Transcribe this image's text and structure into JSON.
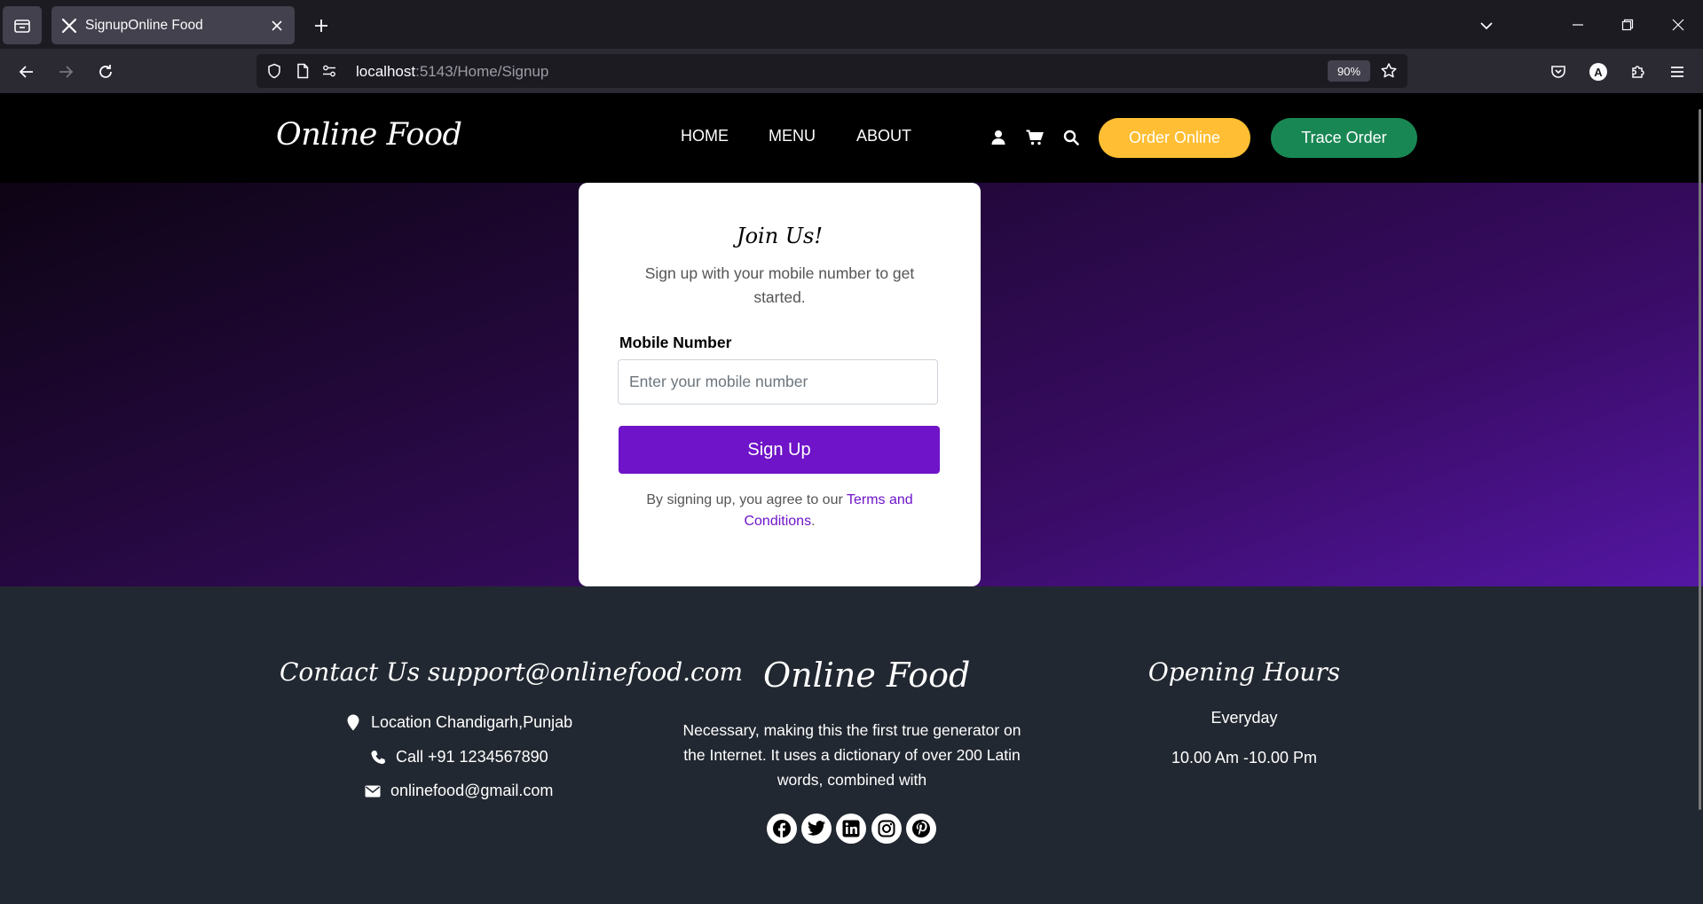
{
  "browser": {
    "tab_title": "SignupOnline Food",
    "url_host": "localhost",
    "url_rest": ":5143/Home/Signup",
    "zoom": "90%"
  },
  "header": {
    "brand": "Online Food",
    "nav": [
      "HOME",
      "MENU",
      "ABOUT"
    ],
    "order_online": "Order Online",
    "trace_order": "Trace Order"
  },
  "signup": {
    "title": "Join Us!",
    "subtitle": "Sign up with your mobile number to get started.",
    "mobile_label": "Mobile Number",
    "mobile_placeholder": "Enter your mobile number",
    "button": "Sign Up",
    "terms_prefix": "By signing up, you agree to our ",
    "terms_link": "Terms and Conditions",
    "terms_suffix": "."
  },
  "footer": {
    "contact_heading": "Contact Us support@onlinefood.com",
    "location": "Location Chandigarh,Punjab",
    "phone": "Call +91 1234567890",
    "email": "onlinefood@gmail.com",
    "brand": "Online Food",
    "description": "Necessary, making this the first true generator on the Internet. It uses a dictionary of over 200 Latin words, combined with",
    "social": [
      "facebook-icon",
      "twitter-icon",
      "linkedin-icon",
      "instagram-icon",
      "pinterest-icon"
    ],
    "hours_heading": "Opening Hours",
    "hours_days": "Everyday",
    "hours_time": "10.00 Am -10.00 Pm"
  },
  "colors": {
    "order_online": "#ffbe33",
    "trace_order": "#198754",
    "signup_button": "#6f14c8",
    "footer_bg": "#222831"
  }
}
